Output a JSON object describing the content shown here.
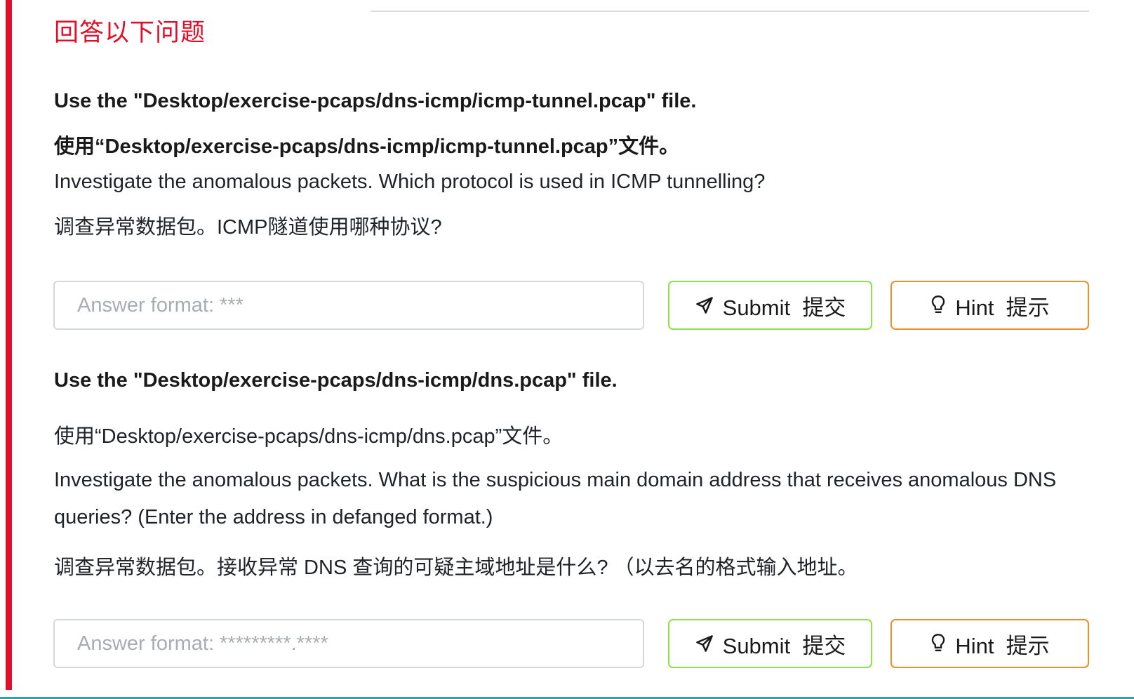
{
  "heading": "回答以下问题",
  "questions": [
    {
      "file_en": "Use the \"Desktop/exercise-pcaps/dns-icmp/icmp-tunnel.pcap\" file.",
      "file_zh": "使用“Desktop/exercise-pcaps/dns-icmp/icmp-tunnel.pcap”文件。",
      "question_en": "Investigate the anomalous packets. Which protocol is used in ICMP tunnelling?",
      "question_zh": "调查异常数据包。ICMP隧道使用哪种协议?",
      "answer_placeholder": "Answer format: ***",
      "answer_value": "",
      "submit_label": "Submit  提交",
      "hint_label": "Hint  提示"
    },
    {
      "file_en": "Use the \"Desktop/exercise-pcaps/dns-icmp/dns.pcap\" file.",
      "file_zh": "使用“Desktop/exercise-pcaps/dns-icmp/dns.pcap”文件。",
      "question_en": "Investigate the anomalous packets. What is the suspicious main domain address that receives anomalous DNS queries? (Enter the address in defanged format.)",
      "question_zh": "调查异常数据包。接收异常 DNS 查询的可疑主域地址是什么? （以去名的格式输入地址。",
      "answer_placeholder": "Answer format: *********.****",
      "answer_value": "",
      "submit_label": "Submit  提交",
      "hint_label": "Hint  提示"
    }
  ],
  "icons": {
    "submit": "send-icon",
    "hint": "lightbulb-icon"
  },
  "colors": {
    "accent_red": "#e0102a",
    "submit_border": "#8fe04a",
    "hint_border": "#f28c24",
    "placeholder": "#a9adb2"
  }
}
